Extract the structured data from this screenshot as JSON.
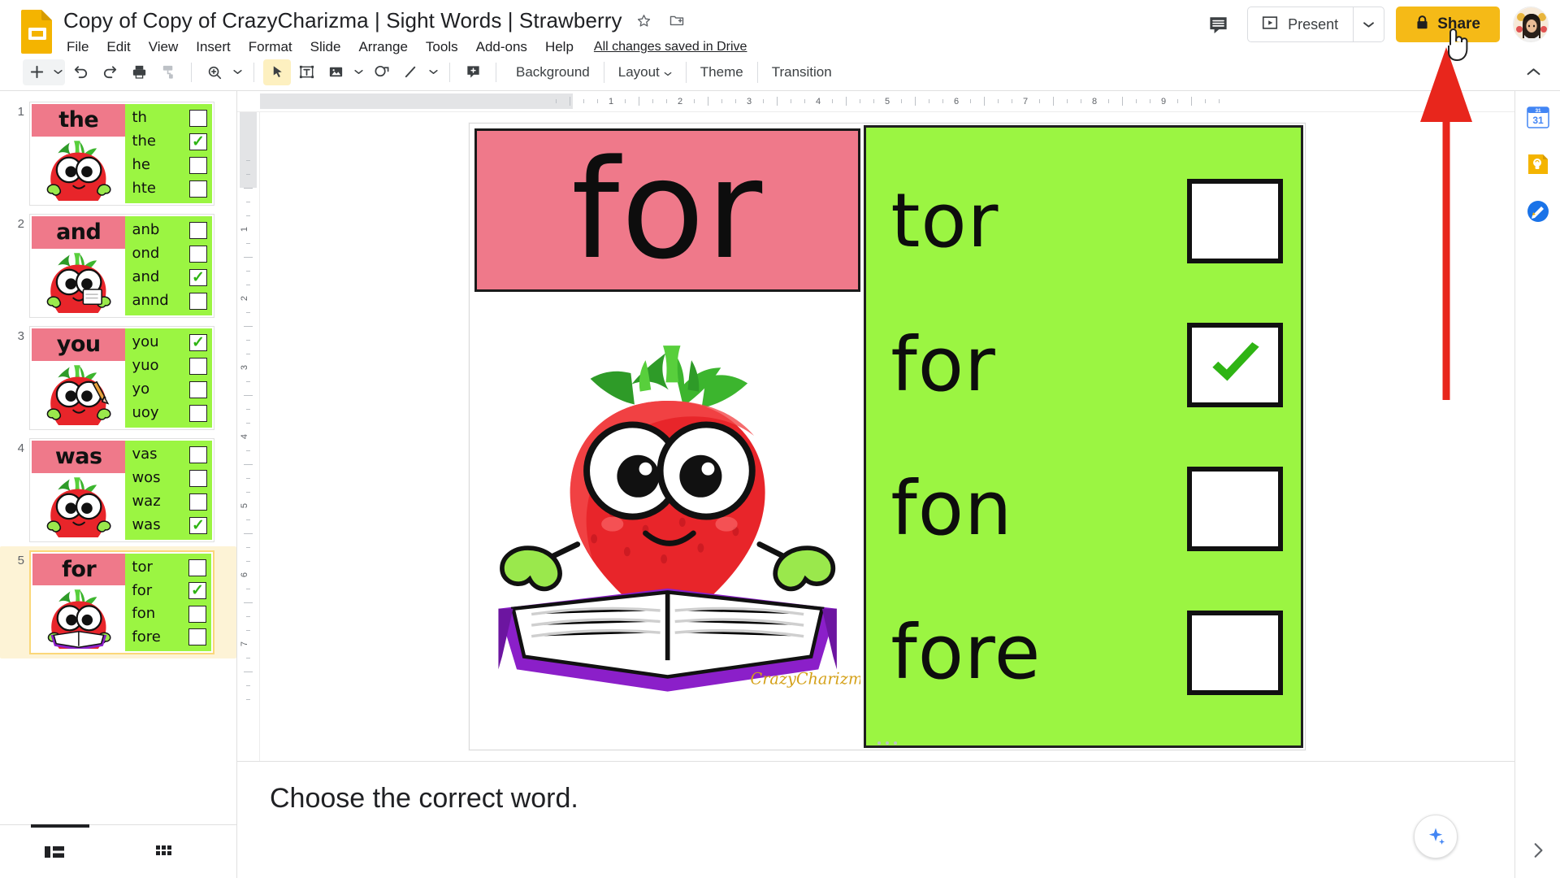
{
  "app": {
    "name": "Google Slides",
    "logo_icon": "slides-logo-icon"
  },
  "header": {
    "doc_title": "Copy of Copy of CrazyCharizma | Sight Words | Strawberry",
    "star_icon": "star-icon",
    "move_icon": "move-to-folder-icon",
    "save_state": "All changes saved in Drive",
    "menus": [
      "File",
      "Edit",
      "View",
      "Insert",
      "Format",
      "Slide",
      "Arrange",
      "Tools",
      "Add-ons",
      "Help"
    ],
    "comment_icon": "comment-icon",
    "present_label": "Present",
    "present_icon": "present-play-icon",
    "present_caret_icon": "chevron-down-icon",
    "share_label": "Share",
    "share_lock_icon": "lock-icon",
    "share_color": "#f5ba17",
    "avatar_icon": "user-avatar"
  },
  "toolbar": {
    "new_slide_icon": "plus-icon",
    "new_slide_caret_icon": "chevron-down-icon",
    "undo_icon": "undo-icon",
    "redo_icon": "redo-icon",
    "print_icon": "print-icon",
    "paint_format_icon": "paint-format-icon",
    "zoom_icon": "zoom-icon",
    "zoom_caret_icon": "chevron-down-icon",
    "select_icon": "cursor-select-icon",
    "textbox_icon": "text-box-icon",
    "image_icon": "image-icon",
    "image_caret_icon": "chevron-down-icon",
    "shape_icon": "shape-icon",
    "line_icon": "line-icon",
    "line_caret_icon": "chevron-down-icon",
    "comment_add_icon": "add-comment-icon",
    "background_label": "Background",
    "layout_label": "Layout",
    "layout_caret_icon": "chevron-down-icon",
    "theme_label": "Theme",
    "transition_label": "Transition",
    "collapse_icon": "chevron-up-icon"
  },
  "filmstrip": {
    "slides": [
      {
        "number": "1",
        "word": "the",
        "picture": "strawberry-waving",
        "options": [
          {
            "text": "th",
            "checked": false
          },
          {
            "text": "the",
            "checked": true
          },
          {
            "text": "he",
            "checked": false
          },
          {
            "text": "hte",
            "checked": false
          }
        ]
      },
      {
        "number": "2",
        "word": "and",
        "picture": "strawberry-writing",
        "options": [
          {
            "text": "anb",
            "checked": false
          },
          {
            "text": "ond",
            "checked": false
          },
          {
            "text": "and",
            "checked": true
          },
          {
            "text": "annd",
            "checked": false
          }
        ]
      },
      {
        "number": "3",
        "word": "you",
        "picture": "strawberry-pencil",
        "options": [
          {
            "text": "you",
            "checked": true
          },
          {
            "text": "yuo",
            "checked": false
          },
          {
            "text": "yo",
            "checked": false
          },
          {
            "text": "uoy",
            "checked": false
          }
        ]
      },
      {
        "number": "4",
        "word": "was",
        "picture": "strawberry-waving",
        "options": [
          {
            "text": "vas",
            "checked": false
          },
          {
            "text": "wos",
            "checked": false
          },
          {
            "text": "waz",
            "checked": false
          },
          {
            "text": "was",
            "checked": true
          }
        ]
      },
      {
        "number": "5",
        "word": "for",
        "picture": "strawberry-book",
        "selected": true,
        "options": [
          {
            "text": "tor",
            "checked": false
          },
          {
            "text": "for",
            "checked": true
          },
          {
            "text": "fon",
            "checked": false
          },
          {
            "text": "fore",
            "checked": false
          }
        ]
      }
    ],
    "filmstrip_view_icon": "filmstrip-view-icon",
    "grid_view_icon": "grid-view-icon"
  },
  "rulers": {
    "horizontal_ticks": [
      "1",
      "2",
      "3",
      "4",
      "5",
      "6",
      "7",
      "8",
      "9"
    ],
    "vertical_ticks": [
      "1",
      "2",
      "3",
      "4",
      "5",
      "6",
      "7"
    ]
  },
  "slide": {
    "word": "for",
    "word_bg": "#ef798a",
    "panel_bg": "#9bf542",
    "picture": "strawberry-reading-book",
    "watermark": "CrazyCharizma",
    "options": [
      {
        "text": "tor",
        "checked": false
      },
      {
        "text": "for",
        "checked": true
      },
      {
        "text": "fon",
        "checked": false
      },
      {
        "text": "fore",
        "checked": false
      }
    ],
    "check_color": "#2fb414"
  },
  "notes": {
    "text": "Choose the correct word.",
    "explore_icon": "explore-icon"
  },
  "rail": {
    "items": [
      {
        "name": "google-calendar-icon",
        "label": "31"
      },
      {
        "name": "google-keep-icon",
        "label": ""
      },
      {
        "name": "google-tasks-icon",
        "label": ""
      }
    ],
    "expand_icon": "chevron-right-icon"
  },
  "annotation": {
    "arrow_color": "#e8261c",
    "cursor_icon": "pointing-hand-cursor"
  }
}
